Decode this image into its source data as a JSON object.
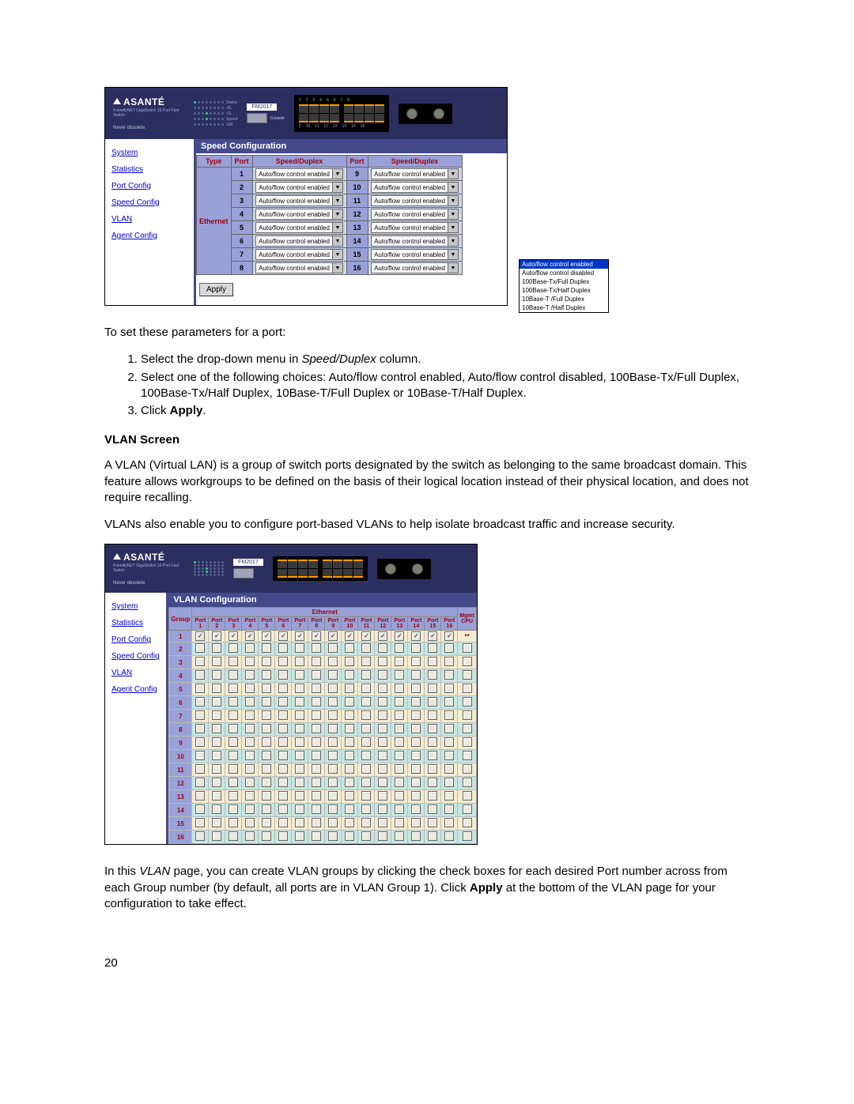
{
  "brand": "ASANTÉ",
  "brand_sub": "FriendlyNET GigaSwitch 16-Port Fast Switch",
  "brand_tag": "Never obsolete",
  "model": "FM2017",
  "led_labels": [
    "Status",
    "•2L",
    "•2L",
    "Speed",
    "100"
  ],
  "console_label": "Console",
  "nav": {
    "system": "System",
    "statistics": "Statistics",
    "port_config": "Port Config",
    "speed_config": "Speed Config",
    "vlan": "VLAN",
    "agent_config": "Agent Config"
  },
  "speed_panel": {
    "title": "Speed Configuration",
    "headers": {
      "type": "Type",
      "port": "Port",
      "sd": "Speed/Duplex"
    },
    "type_label": "Ethernet",
    "option": "Auto/flow control enabled",
    "ports_left": [
      "1",
      "2",
      "3",
      "4",
      "5",
      "6",
      "7",
      "8"
    ],
    "ports_right": [
      "9",
      "10",
      "11",
      "12",
      "13",
      "14",
      "15",
      "16"
    ],
    "apply": "Apply",
    "menu": [
      "Auto/flow control enabled",
      "Auto/flow control disabled",
      "100Base-Tx/Full Duplex",
      "100Base-Tx/Half Duplex",
      "10Base-T /Full Duplex",
      "10Base-T /Half Duplex"
    ]
  },
  "text": {
    "intro": "To set these parameters for a port:",
    "step1a": "Select the drop-down menu in ",
    "step1b": "Speed/Duplex",
    "step1c": " column.",
    "step2": "Select one of the following choices: Auto/flow control enabled, Auto/flow control disabled, 100Base-Tx/Full Duplex, 100Base-Tx/Half Duplex, 10Base-T/Full Duplex or 10Base-T/Half Duplex.",
    "step3a": "Click ",
    "step3b": "Apply",
    "step3c": ".",
    "vlan_heading": "VLAN Screen",
    "vlan_p1": "A VLAN (Virtual LAN) is a group of switch ports designated by the switch as belonging to the same broadcast domain. This feature allows workgroups to be defined on the basis of their logical location instead of their physical location, and does not require recalling.",
    "vlan_p2": "VLANs also enable you to configure port-based VLANs to help isolate broadcast traffic and increase security.",
    "vlan_p3a": "In this ",
    "vlan_p3b": "VLAN",
    "vlan_p3c": " page, you can create VLAN groups by clicking the check boxes for each desired Port number across from each Group number (by default, all ports are in VLAN Group 1).  Click ",
    "vlan_p3d": "Apply",
    "vlan_p3e": " at the bottom of the VLAN page for your configuration to take effect.",
    "page_num": "20"
  },
  "vlan_panel": {
    "title": "VLAN Configuration",
    "group_header": "Group",
    "ethernet_header": "Ethernet",
    "mgmt_header": "Mgmt CPU",
    "port_headers": [
      "Port 1",
      "Port 2",
      "Port 3",
      "Port 4",
      "Port 5",
      "Port 6",
      "Port 7",
      "Port 8",
      "Port 9",
      "Port 10",
      "Port 11",
      "Port 12",
      "Port 13",
      "Port 14",
      "Port 15",
      "Port 16"
    ],
    "groups": [
      "1",
      "2",
      "3",
      "4",
      "5",
      "6",
      "7",
      "8",
      "9",
      "10",
      "11",
      "12",
      "13",
      "14",
      "15",
      "16"
    ],
    "mgmt_mark": "**"
  }
}
